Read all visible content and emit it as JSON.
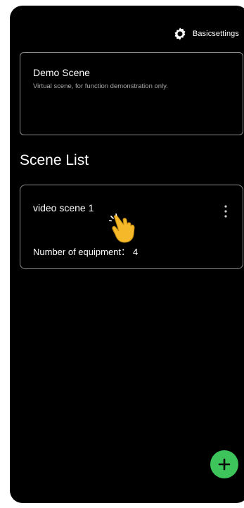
{
  "header": {
    "settings_label": "Basicsettings",
    "settings_icon": "gear-icon"
  },
  "demo_scene": {
    "title": "Demo Scene",
    "subtitle": "Virtual scene, for function demonstration only."
  },
  "scene_list": {
    "title": "Scene List",
    "items": [
      {
        "name": "video scene 1",
        "equipment_label": "Number of equipment：",
        "equipment_count": "4"
      }
    ]
  },
  "fab": {
    "icon": "plus-icon",
    "color": "#3dc45a"
  },
  "overlay": {
    "icon": "pointing-hand-icon",
    "color": "#f5b829"
  }
}
